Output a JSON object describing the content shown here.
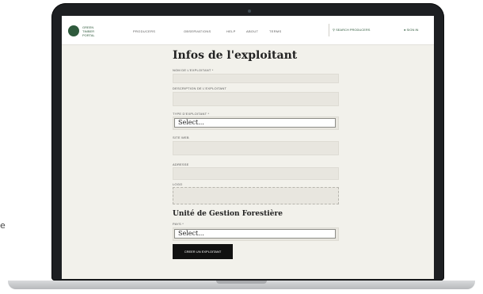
{
  "side_text": "e",
  "nav": {
    "logo_text": "GREEN TIMBER PORTAL",
    "links": [
      "PRODUCERS",
      "OBSERVATIONS",
      "HELP",
      "ABOUT",
      "TERMS"
    ],
    "search": "SEARCH PRODUCERS",
    "signin": "SIGN IN"
  },
  "form": {
    "title": "Infos de l'exploitant",
    "name_label": "NOM DE L'EXPLOITANT *",
    "desc_label": "DESCRIPTION DE L'EXPLOITANT",
    "type_label": "TYPE D'EXPLOITANT *",
    "type_value": "Select...",
    "web_label": "SITE WEB",
    "address_label": "ADRESSE",
    "logo_label": "LOGO",
    "section_title": "Unité de Gestion Forestière",
    "country_label": "PAYS *",
    "country_value": "Select...",
    "submit_label": "CREER UN EXPLOITANT"
  },
  "colors": {
    "brand_green": "#2f5a3c",
    "page_bg": "#f2f1eb",
    "field_bg": "#e8e6df"
  }
}
